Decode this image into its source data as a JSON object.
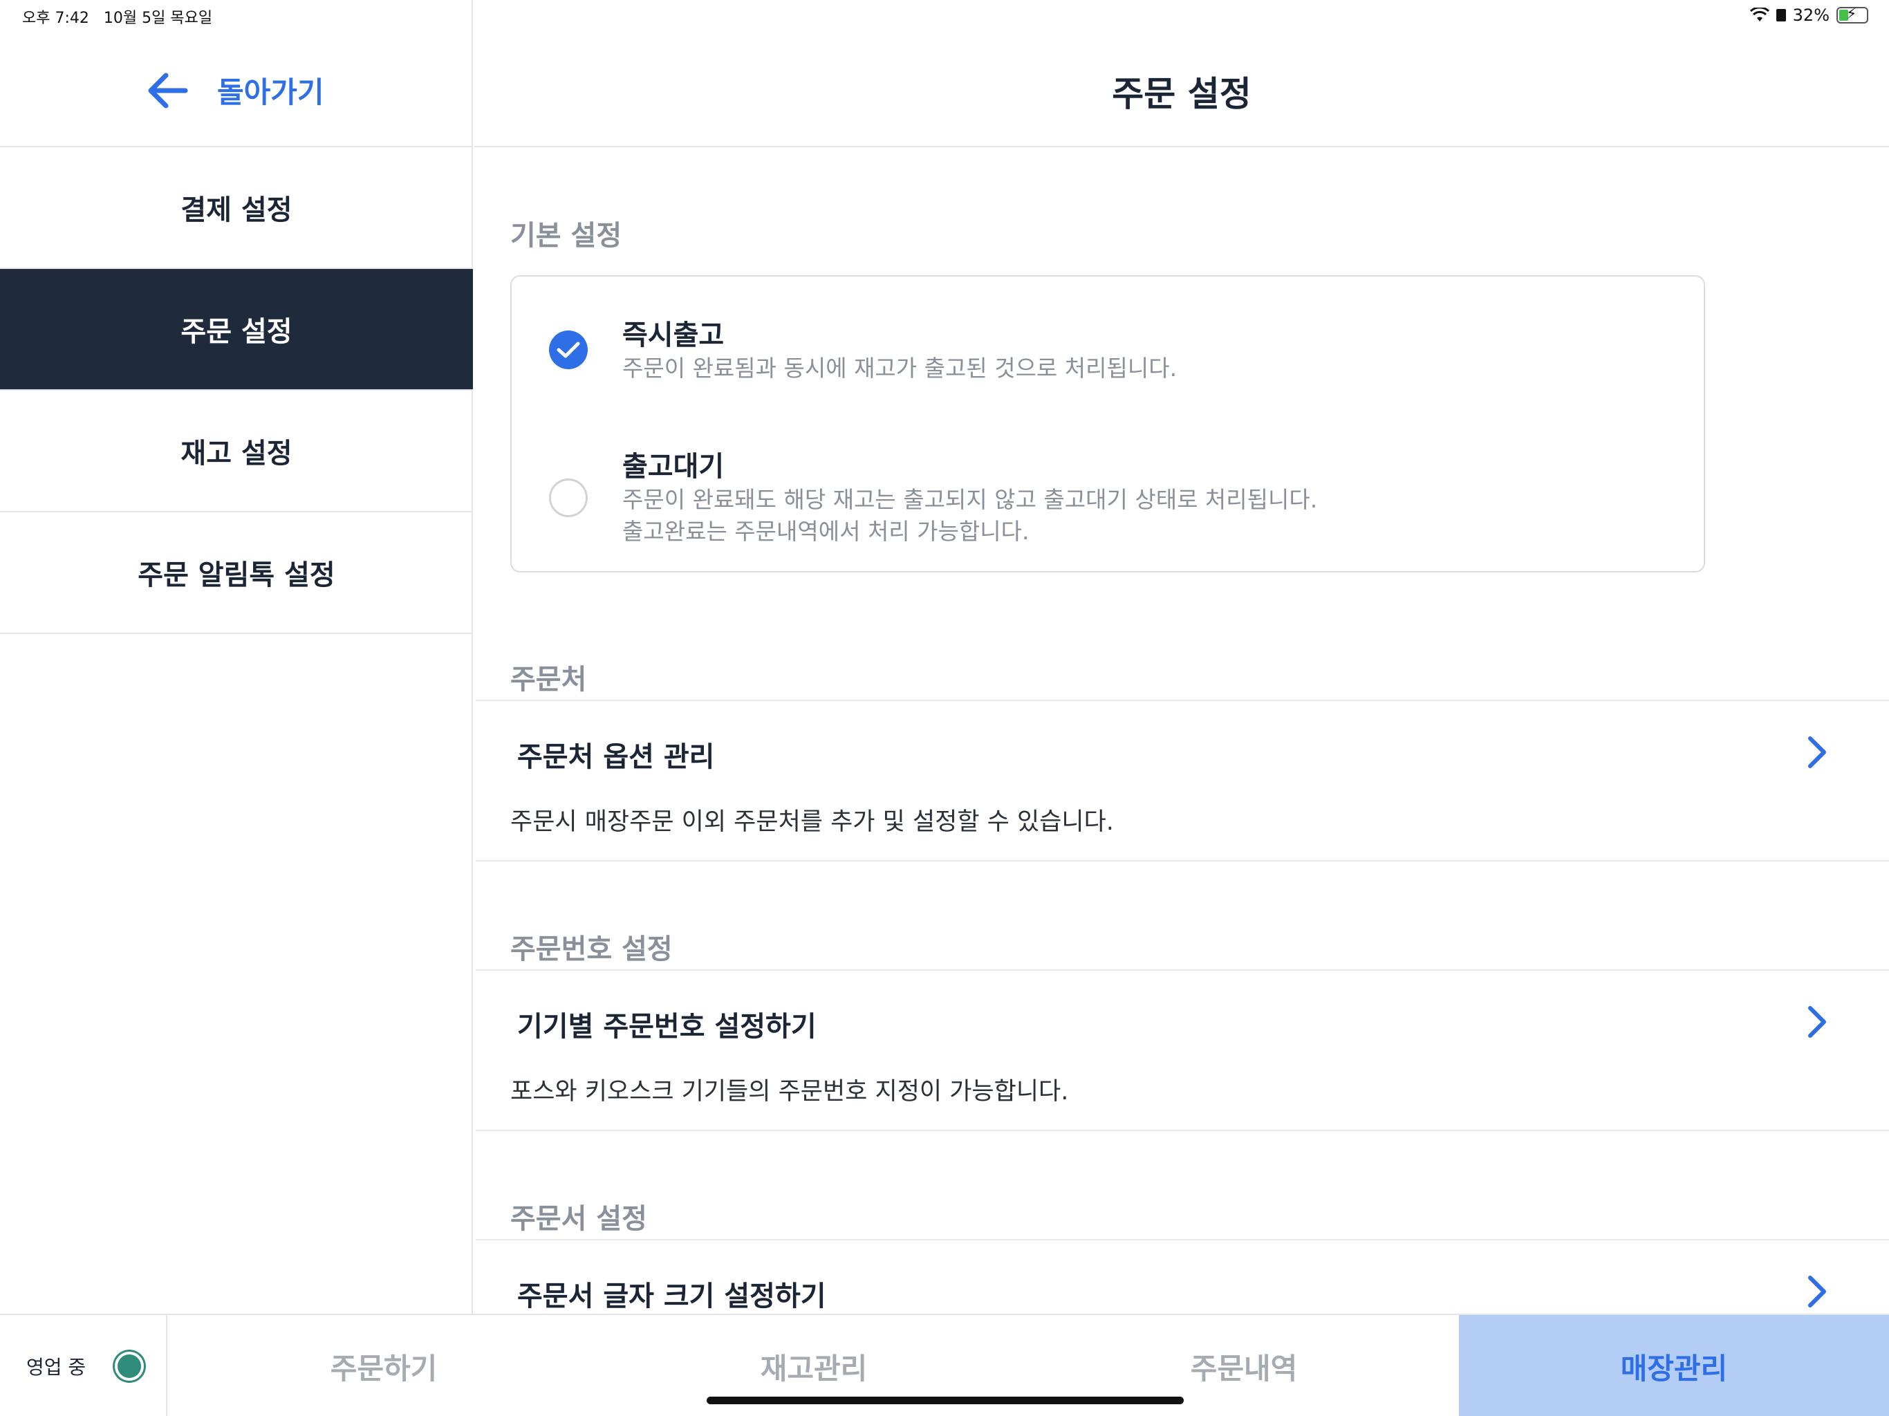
{
  "status_bar": {
    "time": "오후 7:42",
    "date": "10월 5일 목요일",
    "battery": "32%",
    "icons": [
      "wifi-icon",
      "lock-icon",
      "battery-charging-icon"
    ]
  },
  "sidebar": {
    "back_label": "돌아가기",
    "items": [
      {
        "label": "결제 설정",
        "active": false
      },
      {
        "label": "주문 설정",
        "active": true
      },
      {
        "label": "재고 설정",
        "active": false
      },
      {
        "label": "주문 알림톡 설정",
        "active": false
      }
    ]
  },
  "header": {
    "title": "주문 설정"
  },
  "basic": {
    "section_label": "기본 설정",
    "options": [
      {
        "title": "즉시출고",
        "desc": "주문이 완료됨과 동시에 재고가 출고된 것으로 처리됩니다.",
        "selected": true
      },
      {
        "title": "출고대기",
        "desc_line1": "주문이 완료돼도 해당 재고는 출고되지 않고 출고대기 상태로 처리됩니다.",
        "desc_line2": "출고완료는 주문내역에서 처리 가능합니다.",
        "selected": false
      }
    ]
  },
  "order_source": {
    "section_label": "주문처",
    "row_title": "주문처 옵션 관리",
    "row_desc": "주문시 매장주문 이외 주문처를 추가 및 설정할 수 있습니다."
  },
  "order_number": {
    "section_label": "주문번호 설정",
    "row_title": "기기별 주문번호 설정하기",
    "row_desc": "포스와 키오스크 기기들의 주문번호 지정이 가능합니다."
  },
  "order_sheet": {
    "section_label": "주문서 설정",
    "row_title": "주문서 글자 크기 설정하기"
  },
  "tabbar": {
    "open_status": "영업 중",
    "tabs": [
      {
        "label": "주문하기",
        "active": false
      },
      {
        "label": "재고관리",
        "active": false
      },
      {
        "label": "주문내역",
        "active": false
      },
      {
        "label": "매장관리",
        "active": true
      }
    ]
  },
  "colors": {
    "accent": "#2e6ee6",
    "sidebar_active_bg": "#1f2a3d",
    "tab_active_bg": "#b3cdf6",
    "open_dot": "#2f8c7a"
  }
}
